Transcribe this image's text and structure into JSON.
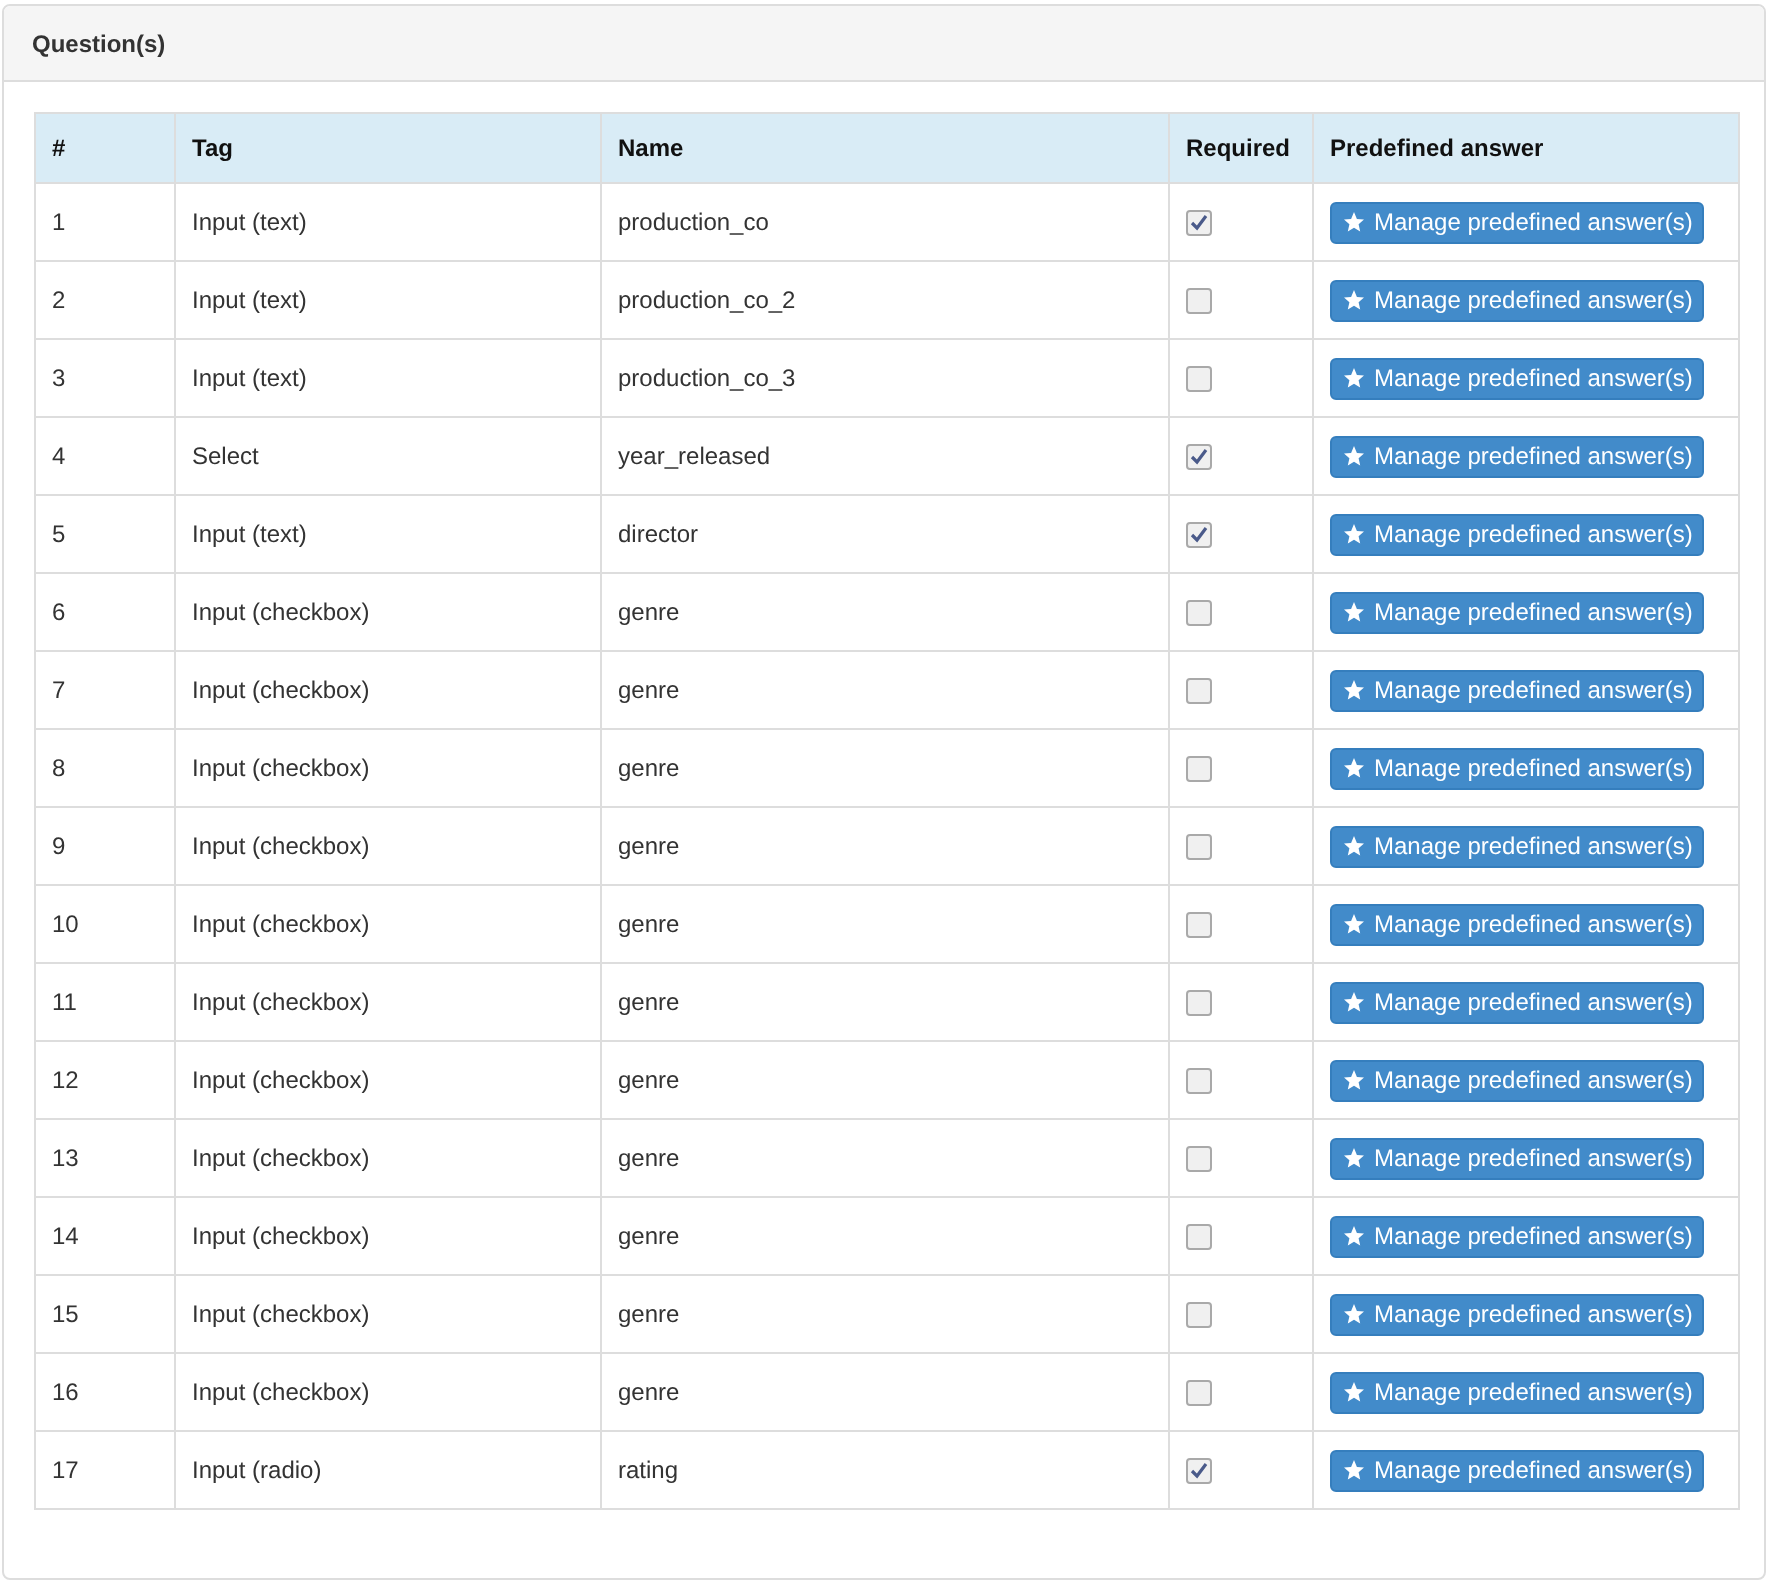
{
  "panel": {
    "title": "Question(s)"
  },
  "table": {
    "columns": [
      "#",
      "Tag",
      "Name",
      "Required",
      "Predefined answer"
    ],
    "rows": [
      {
        "number": "1",
        "tag": "Input (text)",
        "name": "production_co",
        "required": true,
        "action": "Manage predefined answer(s)"
      },
      {
        "number": "2",
        "tag": "Input (text)",
        "name": "production_co_2",
        "required": false,
        "action": "Manage predefined answer(s)"
      },
      {
        "number": "3",
        "tag": "Input (text)",
        "name": "production_co_3",
        "required": false,
        "action": "Manage predefined answer(s)"
      },
      {
        "number": "4",
        "tag": "Select",
        "name": "year_released",
        "required": true,
        "action": "Manage predefined answer(s)"
      },
      {
        "number": "5",
        "tag": "Input (text)",
        "name": "director",
        "required": true,
        "action": "Manage predefined answer(s)"
      },
      {
        "number": "6",
        "tag": "Input (checkbox)",
        "name": "genre",
        "required": false,
        "action": "Manage predefined answer(s)"
      },
      {
        "number": "7",
        "tag": "Input (checkbox)",
        "name": "genre",
        "required": false,
        "action": "Manage predefined answer(s)"
      },
      {
        "number": "8",
        "tag": "Input (checkbox)",
        "name": "genre",
        "required": false,
        "action": "Manage predefined answer(s)"
      },
      {
        "number": "9",
        "tag": "Input (checkbox)",
        "name": "genre",
        "required": false,
        "action": "Manage predefined answer(s)"
      },
      {
        "number": "10",
        "tag": "Input (checkbox)",
        "name": "genre",
        "required": false,
        "action": "Manage predefined answer(s)"
      },
      {
        "number": "11",
        "tag": "Input (checkbox)",
        "name": "genre",
        "required": false,
        "action": "Manage predefined answer(s)"
      },
      {
        "number": "12",
        "tag": "Input (checkbox)",
        "name": "genre",
        "required": false,
        "action": "Manage predefined answer(s)"
      },
      {
        "number": "13",
        "tag": "Input (checkbox)",
        "name": "genre",
        "required": false,
        "action": "Manage predefined answer(s)"
      },
      {
        "number": "14",
        "tag": "Input (checkbox)",
        "name": "genre",
        "required": false,
        "action": "Manage predefined answer(s)"
      },
      {
        "number": "15",
        "tag": "Input (checkbox)",
        "name": "genre",
        "required": false,
        "action": "Manage predefined answer(s)"
      },
      {
        "number": "16",
        "tag": "Input (checkbox)",
        "name": "genre",
        "required": false,
        "action": "Manage predefined answer(s)"
      },
      {
        "number": "17",
        "tag": "Input (radio)",
        "name": "rating",
        "required": true,
        "action": "Manage predefined answer(s)"
      }
    ]
  }
}
